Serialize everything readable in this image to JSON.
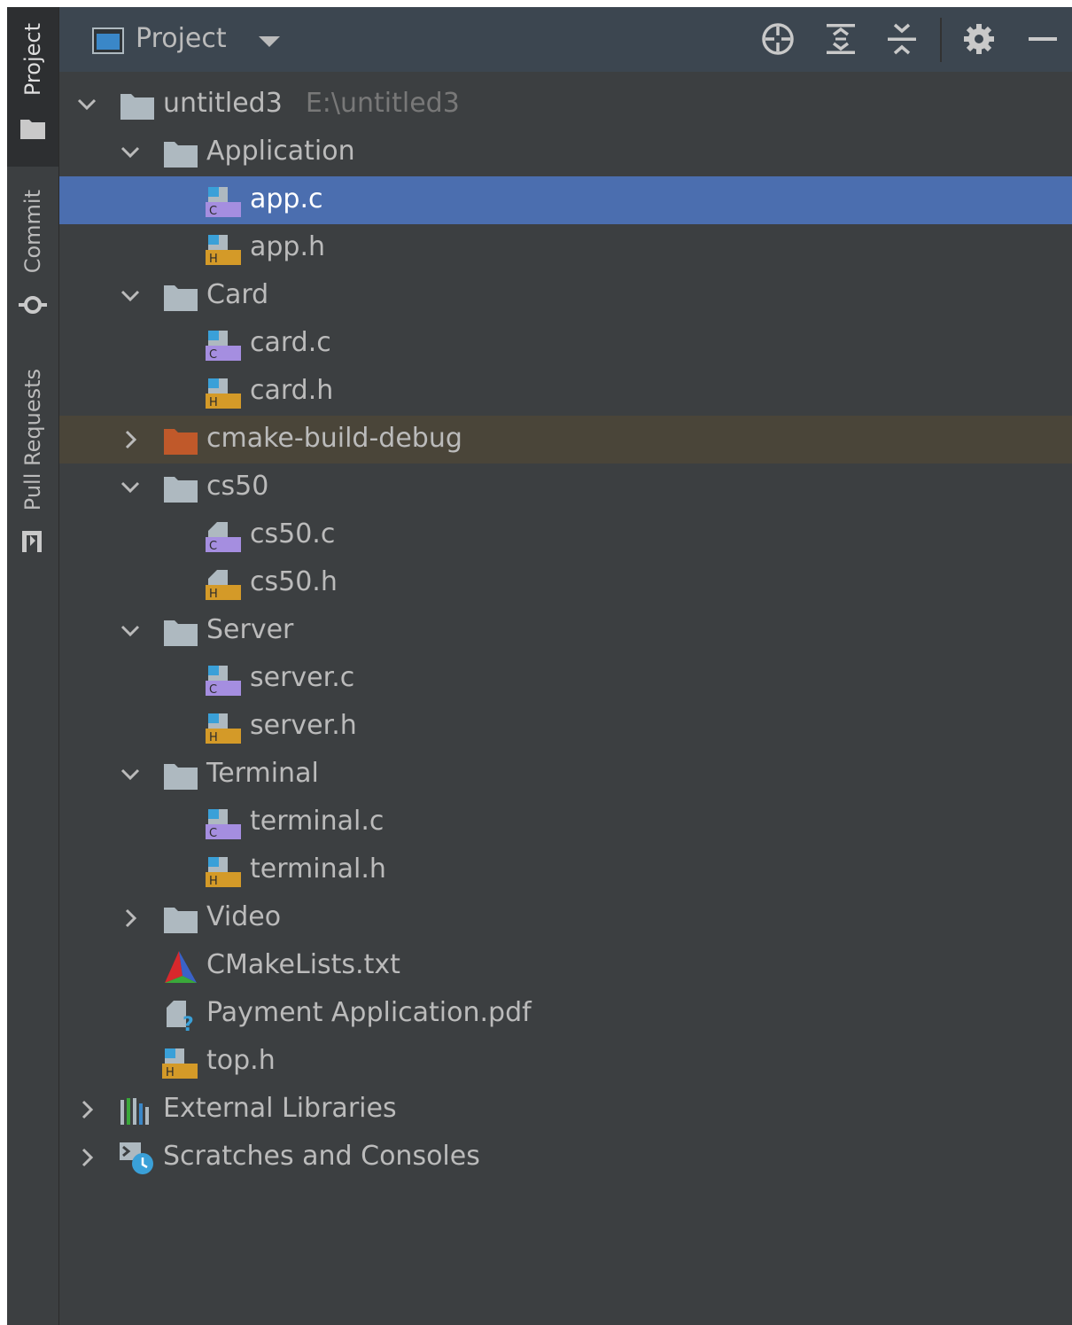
{
  "strip": {
    "tabs": [
      {
        "label": "Project",
        "active": true,
        "icon": "folder-icon"
      },
      {
        "label": "Commit",
        "active": false,
        "icon": "commit-icon"
      },
      {
        "label": "Pull Requests",
        "active": false,
        "icon": "pull-request-icon"
      }
    ]
  },
  "header": {
    "title": "Project",
    "dropdown_icon": "triangle-down-icon",
    "actions": [
      {
        "name": "select-opened-file",
        "icon": "crosshair-icon"
      },
      {
        "name": "expand-all",
        "icon": "expand-all-icon"
      },
      {
        "name": "collapse-all",
        "icon": "collapse-all-icon"
      },
      {
        "name": "options",
        "icon": "gear-icon"
      },
      {
        "name": "hide",
        "icon": "minimize-icon"
      }
    ]
  },
  "colors": {
    "selection": "#4b6eaf",
    "excluded": "#4a4539",
    "folder": "#aeb9c0",
    "excluded_folder": "#c0592a",
    "c_badge": "#a58ee0",
    "h_badge": "#d49a28",
    "header_bg": "#3c4650"
  },
  "tree": {
    "rows": [
      {
        "label": "untitled3",
        "path": "E:\\untitled3",
        "depth": 0,
        "type": "folder",
        "expanded": true
      },
      {
        "label": "Application",
        "depth": 1,
        "type": "folder",
        "expanded": true
      },
      {
        "label": "app.c",
        "depth": 2,
        "type": "c",
        "selected": true
      },
      {
        "label": "app.h",
        "depth": 2,
        "type": "h"
      },
      {
        "label": "Card",
        "depth": 1,
        "type": "folder",
        "expanded": true
      },
      {
        "label": "card.c",
        "depth": 2,
        "type": "c"
      },
      {
        "label": "card.h",
        "depth": 2,
        "type": "h"
      },
      {
        "label": "cmake-build-debug",
        "depth": 1,
        "type": "excluded-folder",
        "expanded": false,
        "excluded": true
      },
      {
        "label": "cs50",
        "depth": 1,
        "type": "folder",
        "expanded": true
      },
      {
        "label": "cs50.c",
        "depth": 2,
        "type": "c-gray"
      },
      {
        "label": "cs50.h",
        "depth": 2,
        "type": "h-gray"
      },
      {
        "label": "Server",
        "depth": 1,
        "type": "folder",
        "expanded": true
      },
      {
        "label": "server.c",
        "depth": 2,
        "type": "c"
      },
      {
        "label": "server.h",
        "depth": 2,
        "type": "h"
      },
      {
        "label": "Terminal",
        "depth": 1,
        "type": "folder",
        "expanded": true
      },
      {
        "label": "terminal.c",
        "depth": 2,
        "type": "c"
      },
      {
        "label": "terminal.h",
        "depth": 2,
        "type": "h"
      },
      {
        "label": "Video",
        "depth": 1,
        "type": "folder",
        "expanded": false
      },
      {
        "label": "CMakeLists.txt",
        "depth": 1,
        "type": "cmake"
      },
      {
        "label": "Payment Application.pdf",
        "depth": 1,
        "type": "unknown"
      },
      {
        "label": "top.h",
        "depth": 1,
        "type": "h"
      },
      {
        "label": "External Libraries",
        "depth": 0,
        "type": "libraries",
        "expanded": false
      },
      {
        "label": "Scratches and Consoles",
        "depth": 0,
        "type": "scratches",
        "expanded": false
      }
    ]
  }
}
